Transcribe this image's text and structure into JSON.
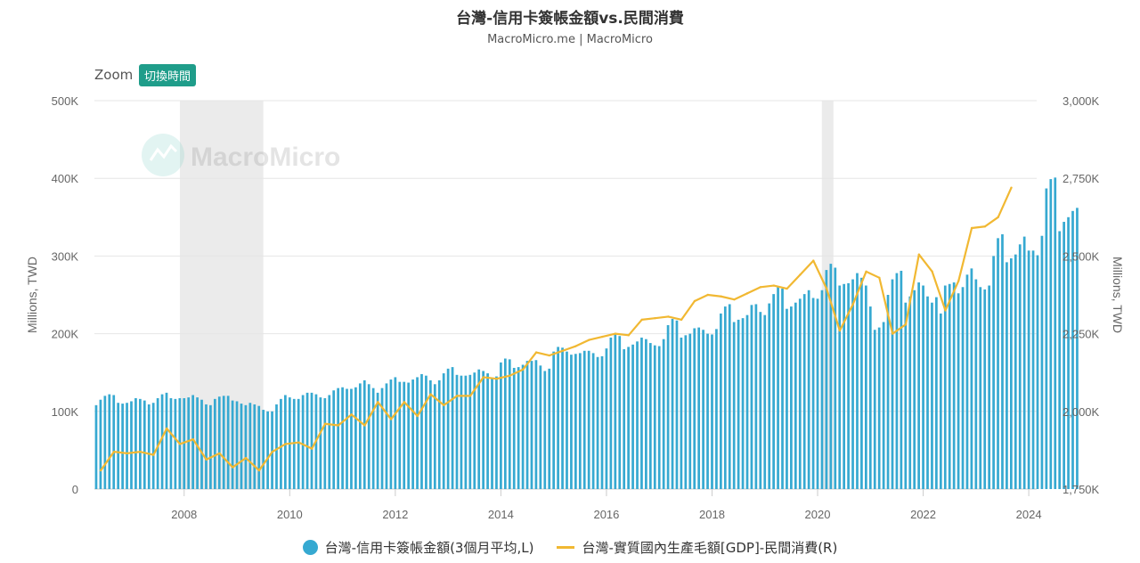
{
  "chart_data": {
    "type": "bar",
    "title": "台灣-信用卡簽帳金額vs.民間消費",
    "subtitle": "MacroMicro.me | MacroMicro",
    "watermark": "MacroMicro",
    "zoom_label": "Zoom",
    "zoom_button": "切換時間",
    "left_axis": {
      "label": "Millions, TWD",
      "ticks": [
        "0",
        "100K",
        "200K",
        "300K",
        "400K",
        "500K"
      ],
      "ylim": [
        0,
        500000
      ]
    },
    "right_axis": {
      "label": "Millions, TWD",
      "ticks": [
        "1,750K",
        "2,000K",
        "2,250K",
        "2,500K",
        "2,750K",
        "3,000K"
      ],
      "ylim": [
        1750000,
        3000000
      ]
    },
    "x_ticks": [
      "2008",
      "2010",
      "2012",
      "2014",
      "2016",
      "2018",
      "2020",
      "2022",
      "2024"
    ],
    "x_range": [
      2006.3,
      2024.15
    ],
    "shaded_periods": [
      [
        2007.92,
        2009.5
      ],
      [
        2020.08,
        2020.3
      ]
    ],
    "colors": {
      "bar": "#36a9d1",
      "line": "#f1b832",
      "shade": "#ebebeb",
      "zoom_button": "#1f9d8a"
    },
    "series": [
      {
        "name": "台灣-信用卡簽帳金額(3個月平均,L)",
        "type": "bar",
        "start": "2006-05",
        "frequency": "monthly",
        "values": [
          108000,
          115000,
          120000,
          122000,
          121000,
          111000,
          110000,
          111000,
          113000,
          117000,
          116000,
          114000,
          109000,
          111000,
          117000,
          122000,
          124000,
          117000,
          116000,
          117000,
          117000,
          118000,
          121000,
          118000,
          115000,
          109000,
          108000,
          116000,
          119000,
          120000,
          120000,
          114000,
          113000,
          110000,
          108000,
          111000,
          109000,
          107000,
          102000,
          100000,
          100000,
          109000,
          116000,
          121000,
          118000,
          116000,
          116000,
          121000,
          124000,
          124000,
          122000,
          118000,
          117000,
          121000,
          127000,
          130000,
          131000,
          129000,
          129000,
          131000,
          136000,
          140000,
          135000,
          130000,
          124000,
          130000,
          136000,
          141000,
          144000,
          138000,
          138000,
          137000,
          141000,
          144000,
          148000,
          146000,
          140000,
          135000,
          140000,
          149000,
          155000,
          157000,
          147000,
          146000,
          146000,
          147000,
          150000,
          154000,
          152000,
          149000,
          143000,
          145000,
          163000,
          168000,
          167000,
          156000,
          157000,
          160000,
          165000,
          165000,
          166000,
          159000,
          152000,
          155000,
          177000,
          183000,
          182000,
          177000,
          173000,
          174000,
          175000,
          178000,
          178000,
          175000,
          170000,
          171000,
          181000,
          195000,
          199000,
          197000,
          180000,
          183000,
          186000,
          190000,
          195000,
          193000,
          188000,
          185000,
          184000,
          193000,
          211000,
          219000,
          217000,
          195000,
          198000,
          200000,
          207000,
          208000,
          205000,
          200000,
          199000,
          206000,
          226000,
          235000,
          238000,
          215000,
          218000,
          220000,
          224000,
          237000,
          238000,
          228000,
          224000,
          239000,
          251000,
          260000,
          258000,
          232000,
          235000,
          240000,
          245000,
          251000,
          256000,
          246000,
          245000,
          256000,
          282000,
          290000,
          285000,
          262000,
          264000,
          265000,
          270000,
          278000,
          272000,
          262000,
          235000,
          205000,
          208000,
          215000,
          250000,
          270000,
          278000,
          281000,
          240000,
          248000,
          256000,
          266000,
          262000,
          248000,
          240000,
          247000,
          226000,
          262000,
          264000,
          266000,
          252000,
          260000,
          276000,
          284000,
          270000,
          260000,
          257000,
          262000,
          300000,
          323000,
          328000,
          292000,
          297000,
          302000,
          315000,
          325000,
          307000,
          307000,
          301000,
          326000,
          387000,
          399000,
          401000,
          332000,
          344000,
          350000,
          358000,
          362000
        ]
      },
      {
        "name": "台灣-實質國內生產毛額[GDP]-民間消費(R)",
        "type": "line",
        "x": [
          2006.42,
          2006.67,
          2006.92,
          2007.17,
          2007.42,
          2007.67,
          2007.92,
          2008.17,
          2008.42,
          2008.67,
          2008.92,
          2009.17,
          2009.42,
          2009.67,
          2009.92,
          2010.17,
          2010.42,
          2010.67,
          2010.92,
          2011.17,
          2011.42,
          2011.67,
          2011.92,
          2012.17,
          2012.42,
          2012.67,
          2012.92,
          2013.17,
          2013.42,
          2013.67,
          2013.92,
          2014.17,
          2014.42,
          2014.67,
          2014.92,
          2015.17,
          2015.42,
          2015.67,
          2015.92,
          2016.17,
          2016.42,
          2016.67,
          2016.92,
          2017.17,
          2017.42,
          2017.67,
          2017.92,
          2018.17,
          2018.42,
          2018.67,
          2018.92,
          2019.17,
          2019.42,
          2019.67,
          2019.92,
          2020.17,
          2020.42,
          2020.67,
          2020.92,
          2021.17,
          2021.42,
          2021.67,
          2021.92,
          2022.17,
          2022.42,
          2022.67,
          2022.92,
          2023.17,
          2023.42,
          2023.67
        ],
        "values": [
          1810000,
          1870000,
          1865000,
          1870000,
          1860000,
          1945000,
          1895000,
          1910000,
          1845000,
          1865000,
          1820000,
          1850000,
          1810000,
          1870000,
          1895000,
          1900000,
          1880000,
          1960000,
          1955000,
          1990000,
          1955000,
          2030000,
          1975000,
          2030000,
          1985000,
          2055000,
          2020000,
          2050000,
          2050000,
          2110000,
          2105000,
          2115000,
          2135000,
          2190000,
          2180000,
          2195000,
          2210000,
          2230000,
          2240000,
          2250000,
          2245000,
          2295000,
          2300000,
          2305000,
          2295000,
          2355000,
          2375000,
          2370000,
          2360000,
          2380000,
          2400000,
          2405000,
          2395000,
          2440000,
          2485000,
          2395000,
          2260000,
          2345000,
          2450000,
          2430000,
          2250000,
          2280000,
          2505000,
          2450000,
          2325000,
          2420000,
          2590000,
          2595000,
          2625000,
          2720000
        ]
      }
    ]
  }
}
